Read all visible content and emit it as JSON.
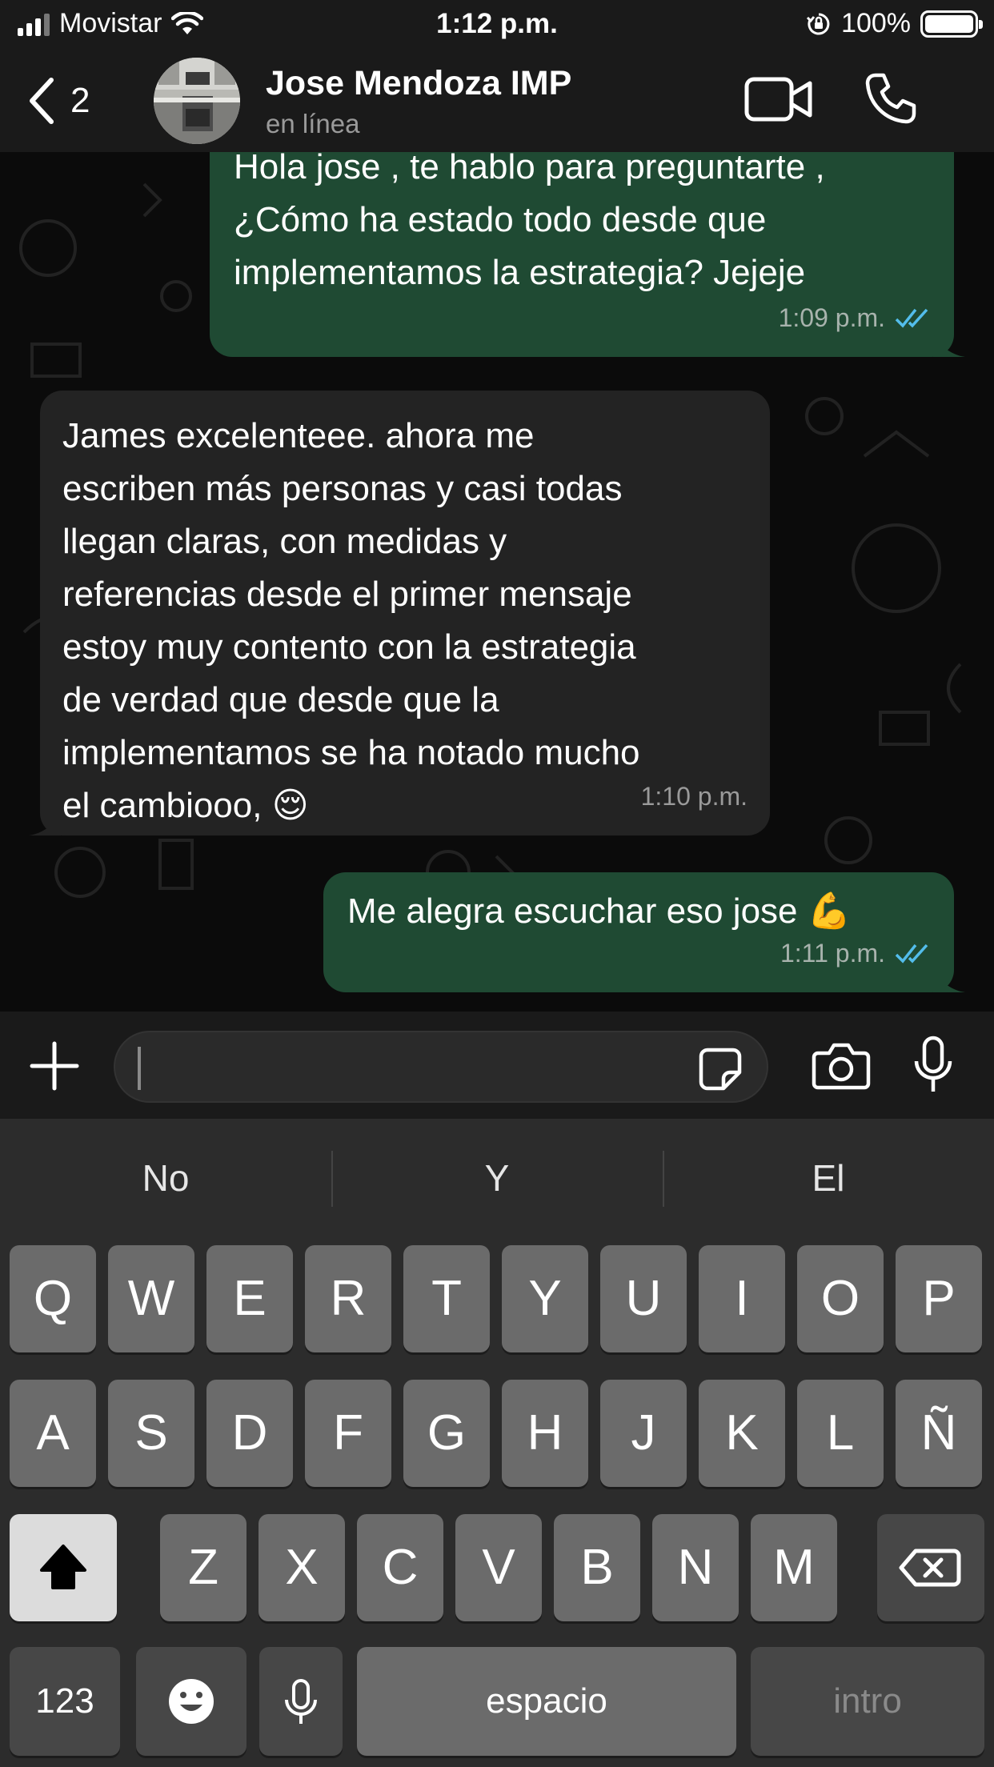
{
  "status_bar": {
    "carrier": "Movistar",
    "time": "1:12 p.m.",
    "battery_percent": "100%",
    "battery_level": 1.0
  },
  "header": {
    "back_count": "2",
    "contact_name": "Jose Mendoza IMP",
    "contact_status": "en línea",
    "icons": [
      "chevron-left-icon",
      "video-call-icon",
      "phone-icon"
    ]
  },
  "messages": [
    {
      "direction": "out",
      "text": "Hola jose , te hablo para preguntarte ,\n¿Cómo ha estado todo desde que\nimplementamos la estrategia?  Jejeje",
      "time": "1:09 p.m.",
      "read": true
    },
    {
      "direction": "in",
      "text": "James excelenteee. ahora me\nescriben más personas y casi todas\nllegan claras, con medidas y\nreferencias desde el primer mensaje\nestoy muy contento con la estrategia\nde verdad que desde que la\nimplementamos se ha notado mucho\nel cambiooo, 😌",
      "time": "1:10 p.m."
    },
    {
      "direction": "out",
      "text": "Me alegra escuchar eso jose 💪",
      "time": "1:11 p.m.",
      "read": true
    }
  ],
  "composer": {
    "input_value": "",
    "icons": [
      "plus-icon",
      "sticker-icon",
      "camera-icon",
      "microphone-icon"
    ]
  },
  "keyboard": {
    "suggestions": [
      "No",
      "Y",
      "El"
    ],
    "row1": [
      "Q",
      "W",
      "E",
      "R",
      "T",
      "Y",
      "U",
      "I",
      "O",
      "P"
    ],
    "row2": [
      "A",
      "S",
      "D",
      "F",
      "G",
      "H",
      "J",
      "K",
      "L",
      "Ñ"
    ],
    "row3": [
      "Z",
      "X",
      "C",
      "V",
      "B",
      "N",
      "M"
    ],
    "numbers_key": "123",
    "space_key": "espacio",
    "return_key": "intro"
  },
  "colors": {
    "outgoing_bubble": "#1f4a33",
    "incoming_bubble": "#232323",
    "read_ticks": "#53bdeb",
    "background": "#0b0b0b"
  }
}
